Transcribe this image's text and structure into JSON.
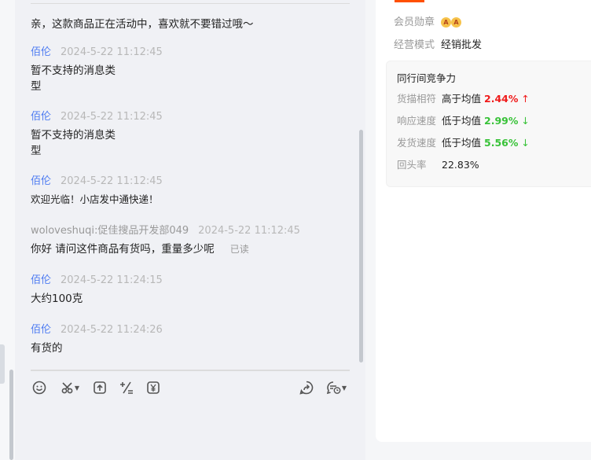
{
  "chat": {
    "first_text": "亲，这款商品正在活动中，喜欢就不要错过哦～",
    "messages": [
      {
        "sender": "佰伦",
        "time": "2024-5-22 11:12:45",
        "text": "暂不支持的消息类\n型"
      },
      {
        "sender": "佰伦",
        "time": "2024-5-22 11:12:45",
        "text": "暂不支持的消息类\n型"
      },
      {
        "sender": "佰伦",
        "time": "2024-5-22 11:12:45",
        "text": "欢迎光临！小店发中通快递！"
      },
      {
        "sender": "woloveshuqi:促佳搜品开发部049",
        "time": "2024-5-22 11:12:45",
        "text": "你好 请问这件商品有货吗，重量多少呢",
        "status": "已读"
      },
      {
        "sender": "佰伦",
        "time": "2024-5-22 11:24:15",
        "text": "大约100克"
      },
      {
        "sender": "佰伦",
        "time": "2024-5-22 11:24:26",
        "text": "有货的"
      }
    ]
  },
  "toolbar": {
    "icons": [
      "emoji-icon",
      "scissors-icon",
      "upload-icon",
      "calculator-icon",
      "price-icon",
      "share-icon",
      "quick-reply-icon"
    ]
  },
  "shop": {
    "badge_label": "会员勋章",
    "badge_text": "A",
    "mode_label": "经营模式",
    "mode_value": "经销批发",
    "competition": {
      "title": "同行间竞争力",
      "rows": [
        {
          "label": "货描相符",
          "compare": "高于均值",
          "value": "2.44%",
          "arrow": "↑",
          "color": "#f01b1b"
        },
        {
          "label": "响应速度",
          "compare": "低于均值",
          "value": "2.99%",
          "arrow": "↓",
          "color": "#38c238"
        },
        {
          "label": "发货速度",
          "compare": "低于均值",
          "value": "5.56%",
          "arrow": "↓",
          "color": "#38c238"
        }
      ],
      "repeat_label": "回头率",
      "repeat_value": "22.83%"
    }
  }
}
